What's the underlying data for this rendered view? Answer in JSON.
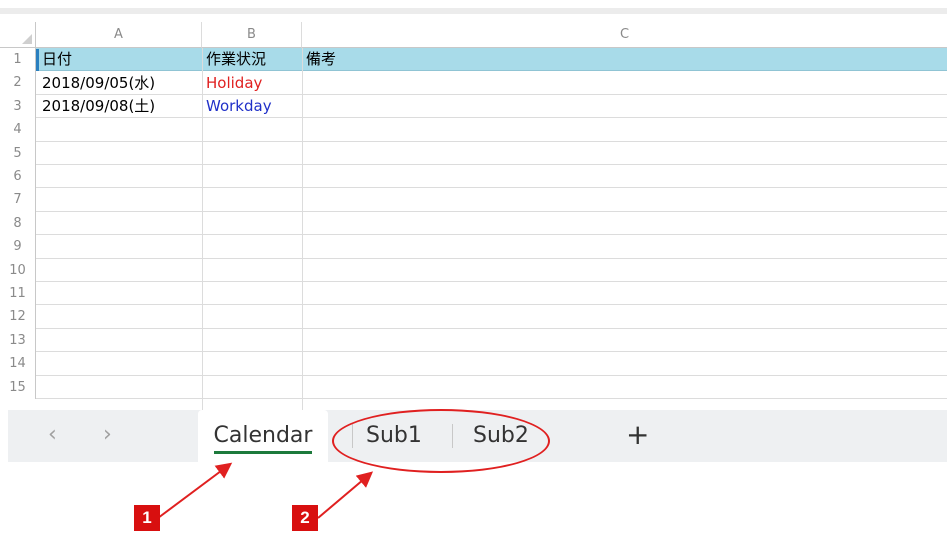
{
  "spreadsheet": {
    "columns": [
      "A",
      "B",
      "C"
    ],
    "rows": [
      {
        "num": "1",
        "a": "日付",
        "b": "作業状況",
        "c": "備考"
      },
      {
        "num": "2",
        "a": "2018/09/05(水)",
        "b": "Holiday",
        "c": ""
      },
      {
        "num": "3",
        "a": "2018/09/08(土)",
        "b": "Workday",
        "c": ""
      },
      {
        "num": "4",
        "a": "",
        "b": "",
        "c": ""
      },
      {
        "num": "5",
        "a": "",
        "b": "",
        "c": ""
      },
      {
        "num": "6",
        "a": "",
        "b": "",
        "c": ""
      },
      {
        "num": "7",
        "a": "",
        "b": "",
        "c": ""
      },
      {
        "num": "8",
        "a": "",
        "b": "",
        "c": ""
      },
      {
        "num": "9",
        "a": "",
        "b": "",
        "c": ""
      },
      {
        "num": "10",
        "a": "",
        "b": "",
        "c": ""
      },
      {
        "num": "11",
        "a": "",
        "b": "",
        "c": ""
      },
      {
        "num": "12",
        "a": "",
        "b": "",
        "c": ""
      },
      {
        "num": "13",
        "a": "",
        "b": "",
        "c": ""
      },
      {
        "num": "14",
        "a": "",
        "b": "",
        "c": ""
      },
      {
        "num": "15",
        "a": "",
        "b": "",
        "c": ""
      }
    ],
    "colors": {
      "header_row": "#a8dbe9",
      "holiday": "#e02020",
      "workday": "#2030c8"
    }
  },
  "tabbar": {
    "prev_icon": "chevron-left-icon",
    "next_icon": "chevron-right-icon",
    "tabs": [
      {
        "label": "Calendar",
        "active": true
      },
      {
        "label": "Sub1",
        "active": false
      },
      {
        "label": "Sub2",
        "active": false
      }
    ],
    "add_icon": "plus-icon",
    "add_label": "+"
  },
  "annotations": {
    "badge1": "1",
    "badge2": "2",
    "color": "#d80f0f"
  }
}
